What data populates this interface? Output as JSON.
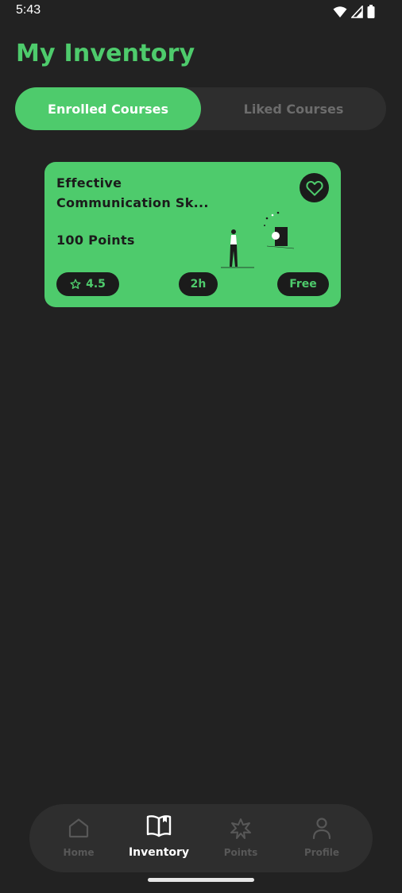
{
  "status_bar": {
    "time": "5:43"
  },
  "header": {
    "title": "My Inventory"
  },
  "tabs": [
    {
      "label": "Enrolled Courses",
      "active": true
    },
    {
      "label": "Liked Courses",
      "active": false
    }
  ],
  "courses": [
    {
      "title": "Effective Communication Sk...",
      "points": "100 Points",
      "rating": "4.5",
      "duration": "2h",
      "price": "Free",
      "like_icon": "heart-outline-icon"
    }
  ],
  "nav": {
    "items": [
      {
        "label": "Home",
        "icon": "home-icon",
        "active": false
      },
      {
        "label": "Inventory",
        "icon": "book-icon",
        "active": true
      },
      {
        "label": "Points",
        "icon": "badge-icon",
        "active": false
      },
      {
        "label": "Profile",
        "icon": "person-icon",
        "active": false
      }
    ]
  },
  "colors": {
    "background": "#222222",
    "accent": "#4ecb6c",
    "surface": "#2e2e2e",
    "card_text": "#1b1b1b",
    "inactive": "#585858"
  }
}
